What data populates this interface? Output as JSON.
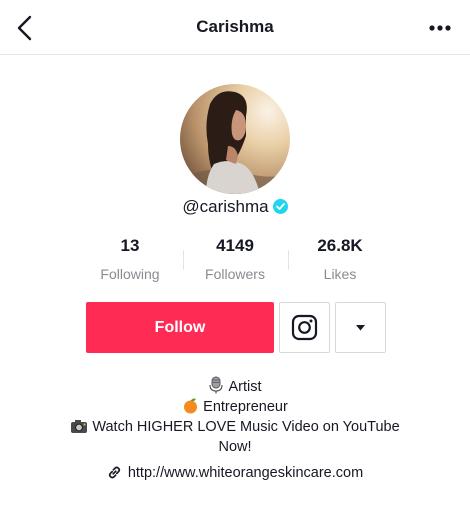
{
  "header": {
    "title": "Carishma"
  },
  "profile": {
    "username": "@carishma"
  },
  "stats": [
    {
      "value": "13",
      "label": "Following"
    },
    {
      "value": "4149",
      "label": "Followers"
    },
    {
      "value": "26.8K",
      "label": "Likes"
    }
  ],
  "actions": {
    "follow_label": "Follow"
  },
  "bio": {
    "lines": [
      {
        "icon": "microphone-emoji-icon",
        "text": "Artist"
      },
      {
        "icon": "orange-emoji-icon",
        "text": "Entrepreneur"
      },
      {
        "icon": "camera-emoji-icon",
        "text": "Watch HIGHER LOVE Music Video on YouTube"
      },
      {
        "icon": "",
        "text": "Now!"
      }
    ]
  },
  "link": {
    "icon": "link-icon",
    "url": "http://www.whiteorangeskincare.com"
  },
  "colors": {
    "accent": "#fe2c55",
    "verified": "#20d5ec",
    "muted": "#8a8b91"
  }
}
